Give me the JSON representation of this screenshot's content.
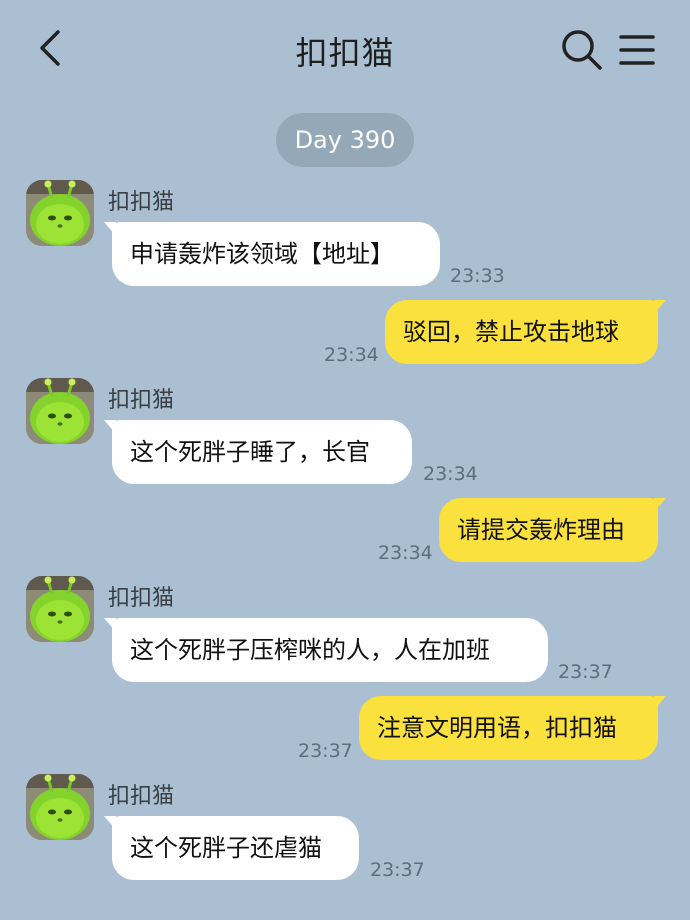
{
  "header": {
    "title": "扣扣猫",
    "back_icon": "chevron-left-icon",
    "search_icon": "search-icon",
    "menu_icon": "hamburger-menu-icon"
  },
  "day_label": "Day 390",
  "colors": {
    "background": "#aabfd2",
    "incoming_bubble": "#ffffff",
    "outgoing_bubble": "#fae13d",
    "day_pill": "#94a8b7"
  },
  "messages": [
    {
      "direction": "incoming",
      "sender": "扣扣猫",
      "text": "申请轰炸该领域【地址】",
      "time": "23:33"
    },
    {
      "direction": "outgoing",
      "text": "驳回，禁止攻击地球",
      "time": "23:34"
    },
    {
      "direction": "incoming",
      "sender": "扣扣猫",
      "text": "这个死胖子睡了，长官",
      "time": "23:34"
    },
    {
      "direction": "outgoing",
      "text": "请提交轰炸理由",
      "time": "23:34"
    },
    {
      "direction": "incoming",
      "sender": "扣扣猫",
      "text": "这个死胖子压榨咪的人，人在加班",
      "time": "23:37"
    },
    {
      "direction": "outgoing",
      "text": "注意文明用语，扣扣猫",
      "time": "23:37"
    },
    {
      "direction": "incoming",
      "sender": "扣扣猫",
      "text": "这个死胖子还虐猫",
      "time": "23:37"
    }
  ]
}
